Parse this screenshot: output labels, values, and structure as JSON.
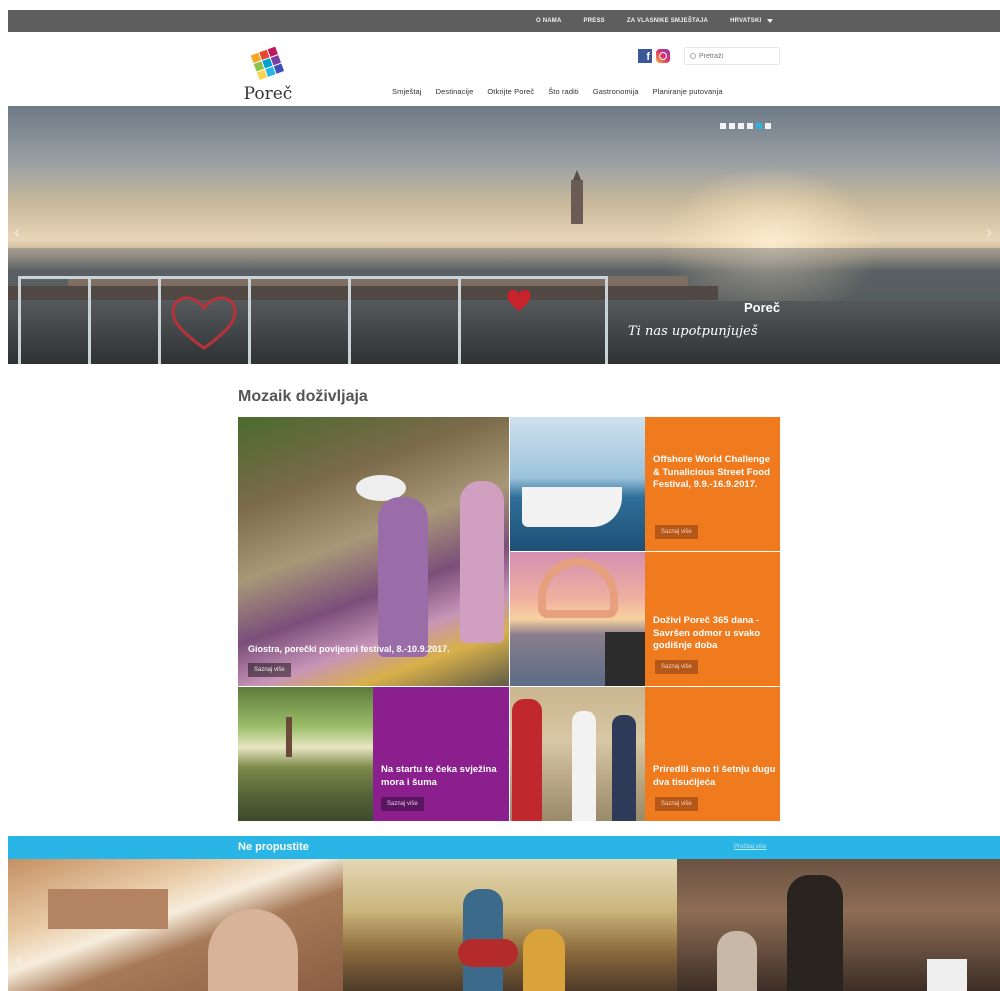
{
  "topbar": {
    "links": [
      "O NAMA",
      "PRESS",
      "ZA VLASNIKE SMJEŠTAJA"
    ],
    "language": "HRVATSKI"
  },
  "header": {
    "logo_text": "Poreč",
    "search_placeholder": "Pretraži",
    "nav": [
      "Smještaj",
      "Destinacije",
      "Otkrijte Poreč",
      "Što raditi",
      "Gastronomija",
      "Planiranje putovanja"
    ]
  },
  "hero": {
    "title": "Poreč",
    "tagline": "Ti nas upotpunjuješ",
    "slide_count": 6,
    "active_slide": 5
  },
  "mosaic": {
    "title": "Mozaik doživljaja",
    "button_label": "Saznaj više",
    "tiles": [
      {
        "text": "Giostra, porečki povijesni festival, 8.-10.9.2017."
      },
      {
        "text": "Offshore World Challenge & Tunalicious Street Food Festival, 9.9.-16.9.2017."
      },
      {
        "text": "Doživi Poreč 365 dana - Savršen odmor u svako godišnje doba"
      },
      {
        "text": "Na startu te čeka svježina mora i šuma"
      },
      {
        "text": "Priredili smo ti šetnju dugu dva tisućljeća"
      }
    ]
  },
  "ne_propustite": {
    "title": "Ne propustite",
    "more_label": "Pročitaj više"
  },
  "colors": {
    "accent_blue": "#29b6e6",
    "orange": "#f07a1e",
    "purple": "#8b1f8d",
    "topbar": "#5e5e5e"
  }
}
